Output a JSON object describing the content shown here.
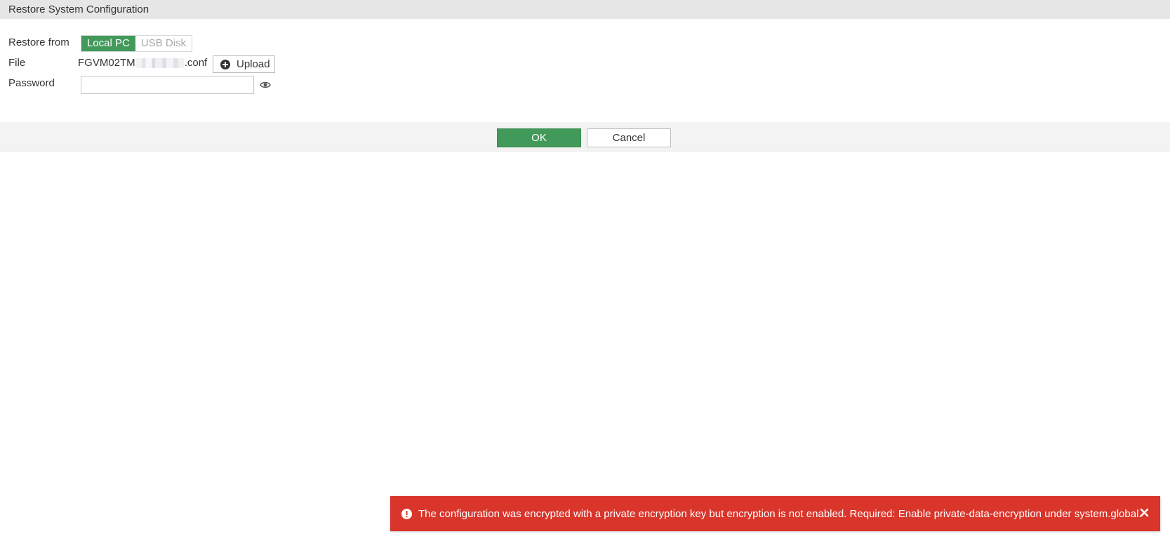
{
  "dialog": {
    "title": "Restore System Configuration"
  },
  "form": {
    "restore_from": {
      "label": "Restore from",
      "options": [
        "Local PC",
        "USB Disk"
      ],
      "selected": "Local PC"
    },
    "file": {
      "label": "File",
      "name_prefix": "FGVM02TM",
      "name_suffix": ".conf",
      "upload_label": "Upload"
    },
    "password": {
      "label": "Password",
      "value": "",
      "placeholder": ""
    }
  },
  "footer": {
    "ok_label": "OK",
    "cancel_label": "Cancel"
  },
  "notification": {
    "type": "error",
    "message": "The configuration was encrypted with a private encryption key but encryption is not enabled. Required: Enable private-data-encryption under system.global."
  },
  "colors": {
    "accent_green": "#419a5a",
    "error_red": "#d9352b",
    "title_bar_bg": "#e6e6e6",
    "footer_bg": "#f3f3f3"
  },
  "icons": {
    "upload": "plus-circle-icon",
    "password_toggle": "eye-icon",
    "notification": "exclamation-circle-icon",
    "notification_close": "close-icon"
  }
}
